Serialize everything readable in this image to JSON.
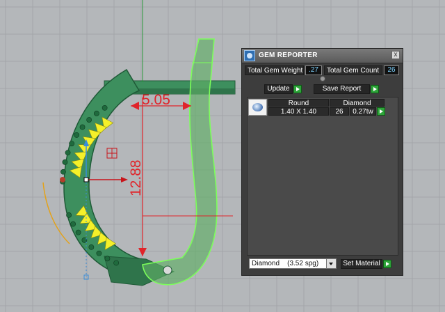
{
  "colors": {
    "viewport_bg": "#b4b7ba",
    "grid_line": "#a3a6a9",
    "ring_fill": "#3d8f5e",
    "ring_edge": "#1f5a37",
    "selected_edge": "#7cff5a",
    "gem_yellow": "#f5f02a",
    "dimension_red": "#e0242a",
    "panel_bg": "#3d3d3d",
    "accent_green": "#2ea43a",
    "value_blue": "#7fd4ff"
  },
  "viewport": {
    "dimension_horizontal": "5.05",
    "dimension_vertical": "12.88"
  },
  "panel": {
    "title": "GEM REPORTER",
    "app_icon": "gem-reporter-logo-icon",
    "close_label": "x",
    "total_gem_weight_label": "Total Gem Weight",
    "total_gem_weight_value": ".27",
    "total_gem_count_label": "Total Gem Count",
    "total_gem_count_value": "26",
    "update_label": "Update",
    "save_report_label": "Save Report",
    "report": {
      "columns": [
        "Round",
        "Diamond"
      ],
      "rows": [
        {
          "shape": "Round",
          "size": "1.40 X 1.40",
          "material": "Diamond",
          "count": "26",
          "weight": "0.27tw"
        }
      ]
    },
    "material_select_value": "Diamond    (3.52 spg)",
    "set_material_label": "Set Material"
  }
}
